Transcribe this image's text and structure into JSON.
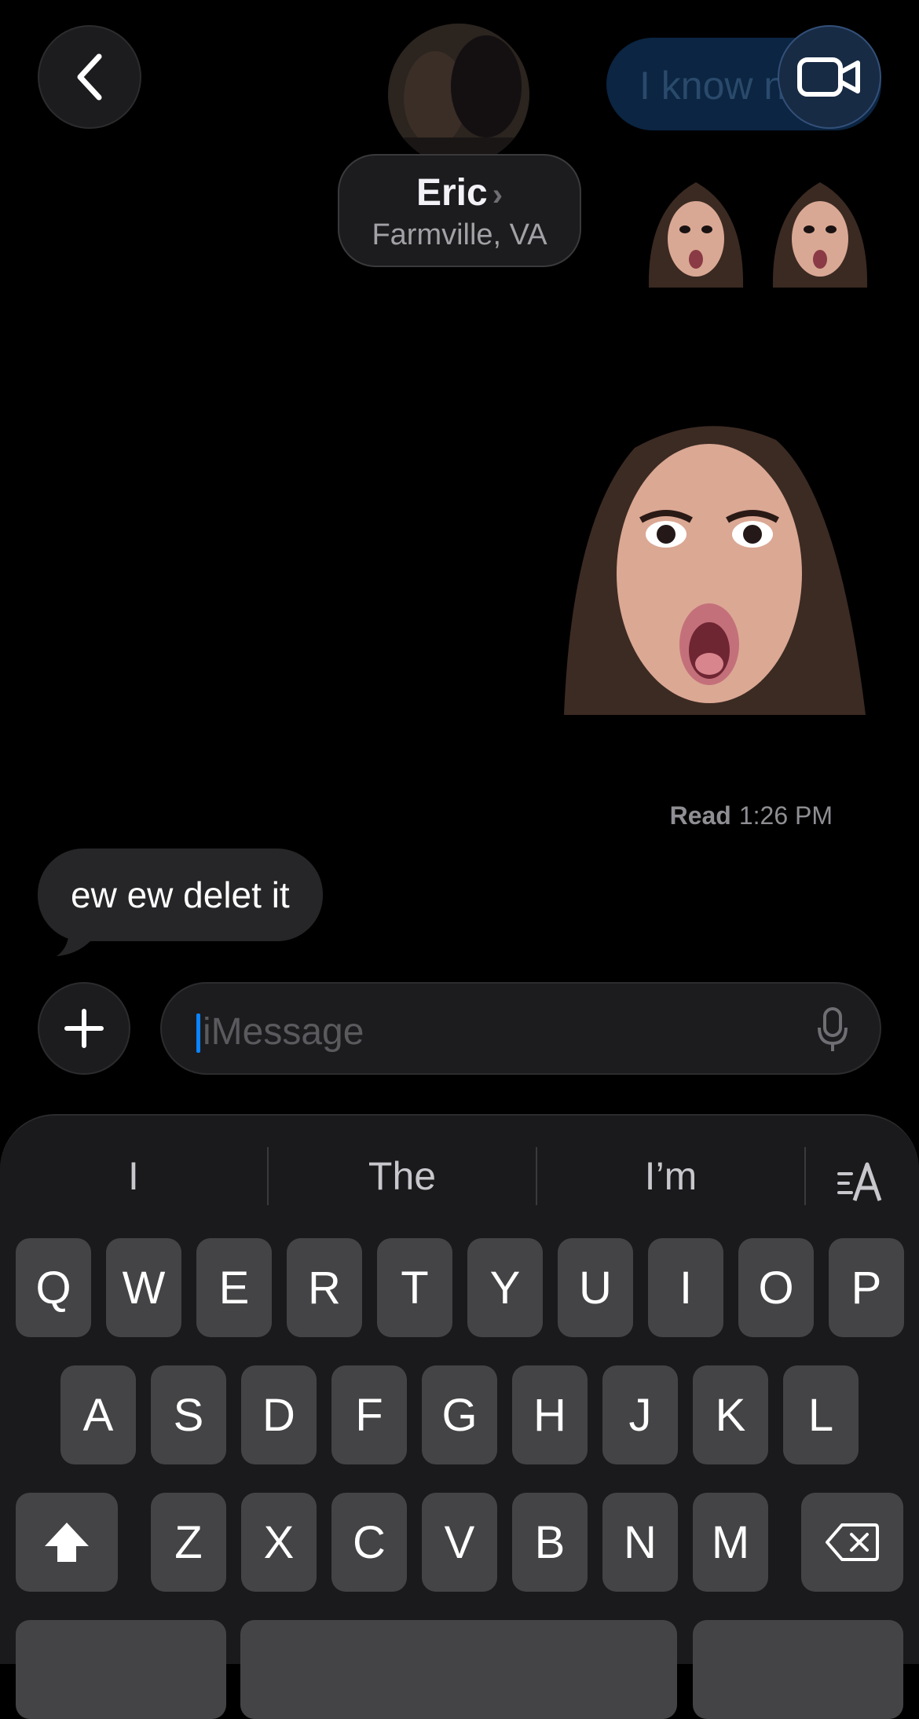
{
  "header": {
    "contact_name": "Eric",
    "contact_chevron": "›",
    "contact_location": "Farmville, VA",
    "sent_bubble_preview": "I know n"
  },
  "messages": {
    "read_label": "Read",
    "read_time": "1:26 PM",
    "received_text": "ew ew delet it"
  },
  "compose": {
    "placeholder": "iMessage"
  },
  "keyboard": {
    "suggestions": [
      "I",
      "The",
      "I’m"
    ],
    "row1": [
      "Q",
      "W",
      "E",
      "R",
      "T",
      "Y",
      "U",
      "I",
      "O",
      "P"
    ],
    "row2": [
      "A",
      "S",
      "D",
      "F",
      "G",
      "H",
      "J",
      "K",
      "L"
    ],
    "row3": [
      "Z",
      "X",
      "C",
      "V",
      "B",
      "N",
      "M"
    ]
  },
  "icons": {
    "back": "chevron-left-icon",
    "video": "video-camera-icon",
    "plus": "plus-icon",
    "mic": "microphone-icon",
    "format": "text-format-icon",
    "shift": "shift-arrow-icon",
    "delete": "backspace-icon"
  },
  "colors": {
    "background": "#000000",
    "bubble_received": "#262628",
    "bubble_sent": "#0b2542",
    "accent": "#0a84ff",
    "key": "#444446"
  }
}
